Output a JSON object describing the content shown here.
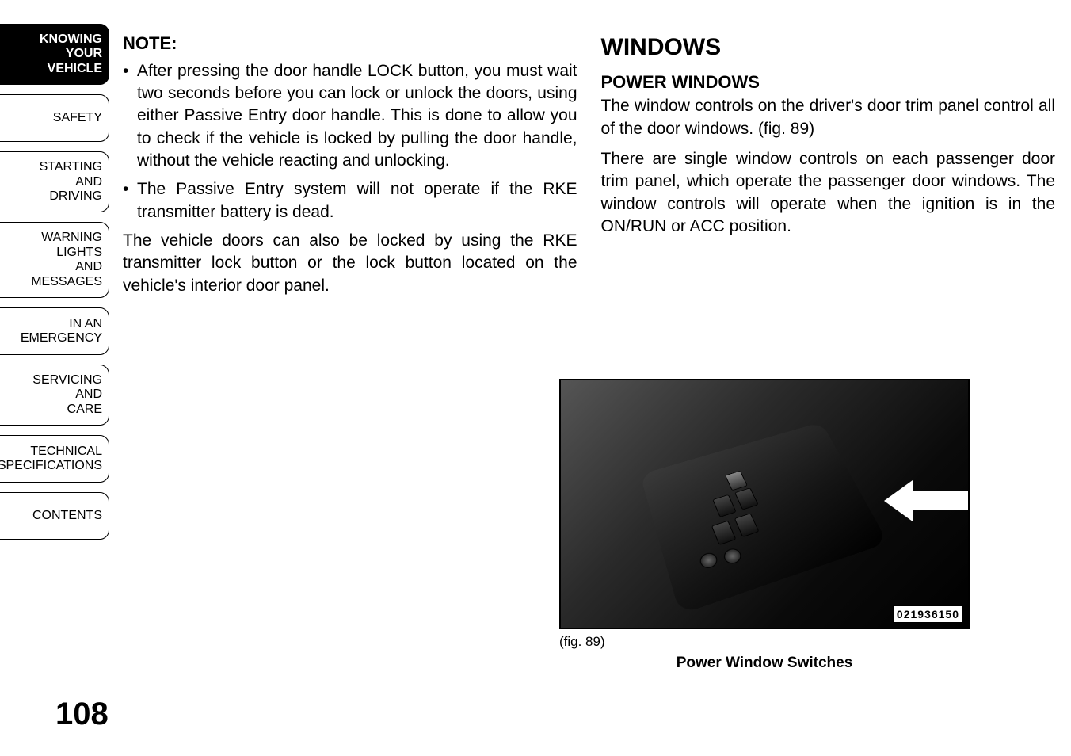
{
  "sidebar": {
    "items": [
      {
        "label": "KNOWING\nYOUR\nVEHICLE",
        "active": true
      },
      {
        "label": "SAFETY",
        "active": false
      },
      {
        "label": "STARTING\nAND\nDRIVING",
        "active": false
      },
      {
        "label": "WARNING\nLIGHTS\nAND\nMESSAGES",
        "active": false
      },
      {
        "label": "IN AN\nEMERGENCY",
        "active": false
      },
      {
        "label": "SERVICING\nAND\nCARE",
        "active": false
      },
      {
        "label": "TECHNICAL\nSPECIFICATIONS",
        "active": false
      },
      {
        "label": "CONTENTS",
        "active": false
      }
    ]
  },
  "left_column": {
    "note_heading": "NOTE:",
    "bullets": [
      "After pressing the door handle LOCK button, you must wait two seconds before you can lock or unlock the doors, using either Passive Entry door handle. This is done to allow you to check if the vehicle is locked by pulling the door handle, without the vehicle reacting and unlocking.",
      "The Passive Entry system will not operate if the RKE transmitter battery is dead."
    ],
    "paragraph": "The vehicle doors can also be locked by using the RKE transmitter lock button or the lock button located on the vehicle's interior door panel."
  },
  "right_column": {
    "h1": "WINDOWS",
    "h2": "POWER WINDOWS",
    "p1": "The window controls on the driver's door trim panel control all of the door windows.  (fig. 89)",
    "p2": "There are single window controls on each passenger door trim panel, which operate the passenger door windows. The window controls will operate when the ignition is in the ON/RUN or ACC position."
  },
  "figure": {
    "id_label": "021936150",
    "ref": "(fig. 89)",
    "caption": "Power Window Switches"
  },
  "page_number": "108"
}
